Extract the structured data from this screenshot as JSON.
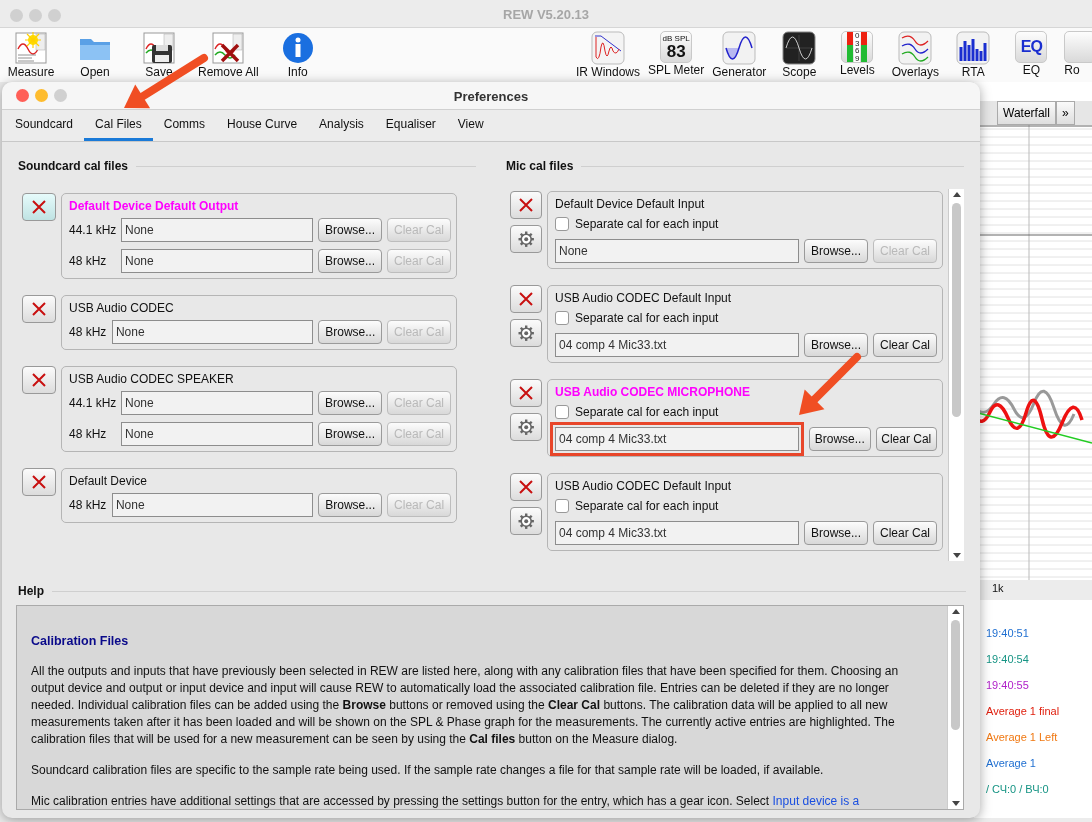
{
  "app": {
    "title": "REW V5.20.13",
    "toolbar_left": [
      {
        "label": "Measure",
        "kind": "measure"
      },
      {
        "label": "Open",
        "kind": "open"
      },
      {
        "label": "Save",
        "kind": "save"
      },
      {
        "label": "Remove All",
        "kind": "remove_all"
      },
      {
        "label": "Info",
        "kind": "info"
      }
    ],
    "toolbar_right": [
      {
        "label": "IR Windows",
        "kind": "ir_windows"
      },
      {
        "label": "SPL Meter",
        "kind": "spl_meter",
        "icon_text": [
          "dB SPL",
          "83"
        ]
      },
      {
        "label": "Generator",
        "kind": "generator"
      },
      {
        "label": "Scope",
        "kind": "scope"
      },
      {
        "label": "Levels",
        "kind": "levels",
        "icon_text": [
          "0369"
        ]
      },
      {
        "label": "Overlays",
        "kind": "overlays"
      },
      {
        "label": "RTA",
        "kind": "rta"
      },
      {
        "label": "EQ",
        "kind": "eq",
        "icon_text": [
          "EQ"
        ]
      },
      {
        "label": "Ro",
        "kind": "partial"
      }
    ]
  },
  "dialog": {
    "title": "Preferences",
    "tabs": [
      {
        "label": "Soundcard",
        "selected": false,
        "annotated": false
      },
      {
        "label": "Cal Files",
        "selected": true,
        "annotated": true
      },
      {
        "label": "Comms",
        "selected": false,
        "annotated": false
      },
      {
        "label": "House Curve",
        "selected": false,
        "annotated": false
      },
      {
        "label": "Analysis",
        "selected": false,
        "annotated": false
      },
      {
        "label": "Equaliser",
        "selected": false,
        "annotated": false
      },
      {
        "label": "View",
        "selected": false,
        "annotated": false
      }
    ],
    "soundcard": {
      "heading": "Soundcard cal files",
      "devices": [
        {
          "name": "Default Device Default Output",
          "active": true,
          "focused": true,
          "rates": [
            {
              "rate": "44.1 kHz",
              "file": "None",
              "browse": "Browse...",
              "clear": "Clear Cal",
              "clear_disabled": true
            },
            {
              "rate": "48 kHz",
              "file": "None",
              "browse": "Browse...",
              "clear": "Clear Cal",
              "clear_disabled": true
            }
          ]
        },
        {
          "name": "USB Audio CODEC",
          "active": false,
          "focused": false,
          "rates": [
            {
              "rate": "48 kHz",
              "file": "None",
              "browse": "Browse...",
              "clear": "Clear Cal",
              "clear_disabled": true
            }
          ]
        },
        {
          "name": "USB Audio CODEC  SPEAKER",
          "active": false,
          "focused": false,
          "rates": [
            {
              "rate": "44.1 kHz",
              "file": "None",
              "browse": "Browse...",
              "clear": "Clear Cal",
              "clear_disabled": true
            },
            {
              "rate": "48 kHz",
              "file": "None",
              "browse": "Browse...",
              "clear": "Clear Cal",
              "clear_disabled": true
            }
          ]
        },
        {
          "name": "Default Device",
          "active": false,
          "focused": false,
          "rates": [
            {
              "rate": "48 kHz",
              "file": "None",
              "browse": "Browse...",
              "clear": "Clear Cal",
              "clear_disabled": true
            }
          ]
        }
      ]
    },
    "mic": {
      "heading": "Mic cal files",
      "devices": [
        {
          "name": "Default Device Default Input",
          "active": false,
          "checkbox_label": "Separate cal for each input",
          "checked": false,
          "file": "None",
          "browse": "Browse...",
          "clear": "Clear Cal",
          "clear_disabled": true,
          "annotated": false
        },
        {
          "name": "USB Audio CODEC  Default Input",
          "active": false,
          "checkbox_label": "Separate cal for each input",
          "checked": false,
          "file": "04 comp 4 Mic33.txt",
          "browse": "Browse...",
          "clear": "Clear Cal",
          "clear_disabled": false,
          "annotated": false
        },
        {
          "name": "USB Audio CODEC  MICROPHONE",
          "active": true,
          "checkbox_label": "Separate cal for each input",
          "checked": false,
          "file": "04 comp 4 Mic33.txt",
          "browse": "Browse...",
          "clear": "Clear Cal",
          "clear_disabled": false,
          "annotated": true
        },
        {
          "name": "USB Audio CODEC Default Input",
          "active": false,
          "checkbox_label": "Separate cal for each input",
          "checked": false,
          "file": "04 comp 4 Mic33.txt",
          "browse": "Browse...",
          "clear": "Clear Cal",
          "clear_disabled": false,
          "annotated": false
        }
      ]
    },
    "help": {
      "heading": "Help",
      "title": "Calibration Files",
      "paragraphs": [
        {
          "text": "All the outputs and inputs that have previously been selected in REW are listed here, along with any calibration files that have been specified for them. Choosing an output device and output or input device and input will cause REW to automatically load the associated calibration file. Entries can be deleted if they are no longer needed. Individual calibration files can be added using the **Browse** buttons or removed using the **Clear Cal** buttons. The calibration data will be applied to all new measurements taken after it has been loaded and will be shown on the SPL & Phase graph for the measurements. The currently active entries are highlighted. The calibration files that will be used for a new measurement can be seen by using the **Cal files** button on the Measure dialog."
        },
        {
          "text": "Soundcard calibration files are specific to the sample rate being used. If the sample rate changes a file for that sample rate will be loaded, if available."
        },
        {
          "text": "Mic calibration entries have additional settings that are accessed by pressing the settings button for the entry, which has a gear icon. Select ",
          "link": "Input device is a"
        }
      ]
    }
  },
  "background": {
    "tabs": [
      {
        "label": "Waterfall"
      },
      {
        "label": "»"
      }
    ],
    "axis_label": "1k",
    "legend": [
      {
        "text": "19:40:51",
        "color": "#1f6fd1"
      },
      {
        "text": "19:40:54",
        "color": "#169484"
      },
      {
        "text": "19:40:55",
        "color": "#b01fc8"
      },
      {
        "text": "Average 1 final",
        "color": "#e0200f"
      },
      {
        "text": "Average 1 Left",
        "color": "#f07812"
      },
      {
        "text": "Average 1",
        "color": "#1f6fd1"
      },
      {
        "text": "/ СЧ:0 / ВЧ:0",
        "color": "#169484"
      }
    ]
  }
}
